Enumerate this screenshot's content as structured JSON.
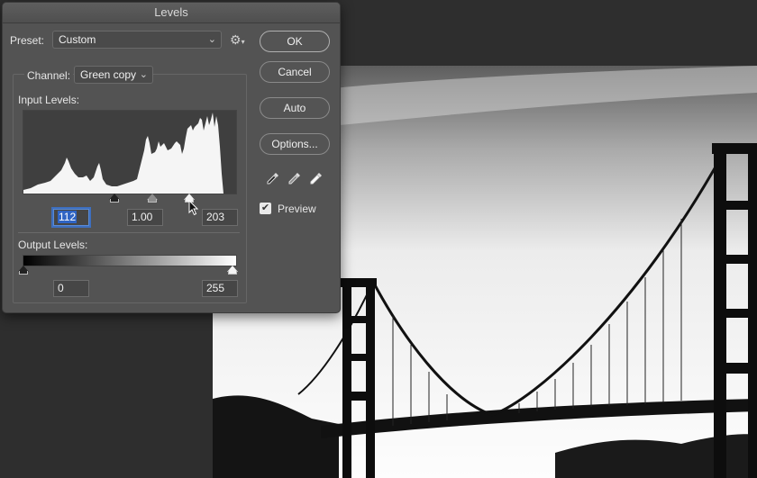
{
  "dialog": {
    "title": "Levels",
    "preset": {
      "label": "Preset:",
      "value": "Custom"
    },
    "channel": {
      "label": "Channel:",
      "value": "Green copy"
    },
    "input_levels": {
      "label": "Input Levels:",
      "black": "112",
      "gamma": "1.00",
      "white": "203",
      "black_point": 112,
      "gamma_point": 1.0,
      "white_point": 203
    },
    "output_levels": {
      "label": "Output Levels:",
      "black": "0",
      "white": "255",
      "black_point": 0,
      "white_point": 255
    },
    "buttons": {
      "ok": "OK",
      "cancel": "Cancel",
      "auto": "Auto",
      "options": "Options..."
    },
    "preview": {
      "label": "Preview",
      "checked": true
    }
  },
  "icons": [
    "chevron-down-icon",
    "gear-icon",
    "black-eyedropper-icon",
    "gray-eyedropper-icon",
    "white-eyedropper-icon",
    "checkmark-icon",
    "mouse-cursor-icon"
  ]
}
